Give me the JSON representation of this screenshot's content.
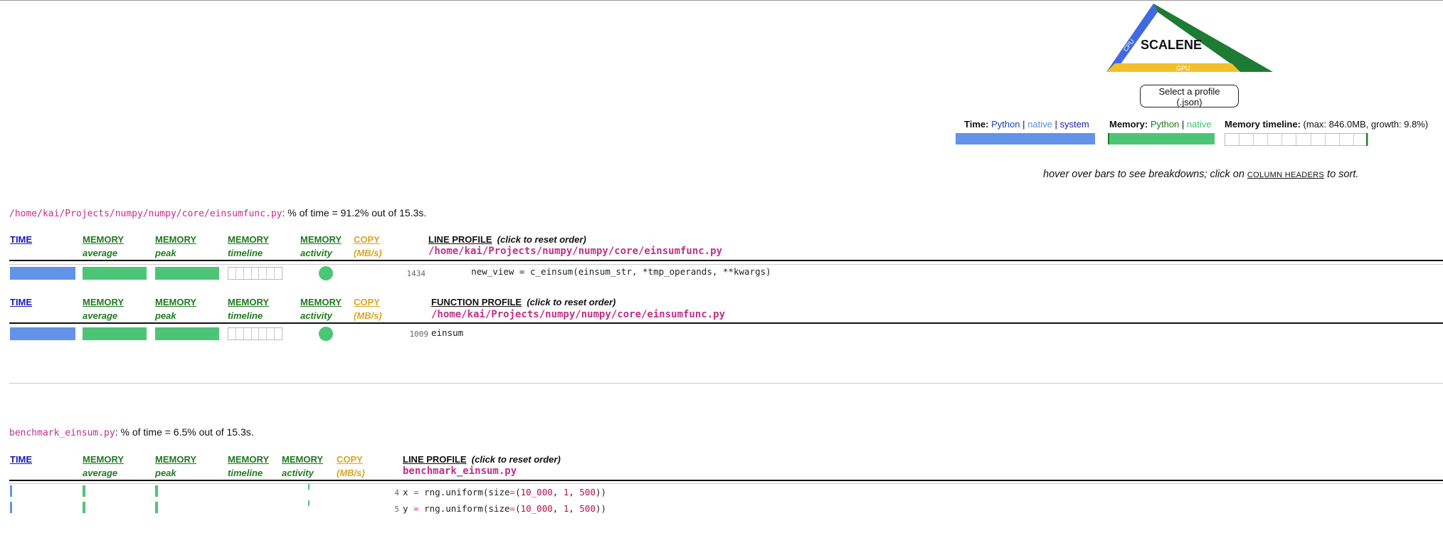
{
  "logo": {
    "name": "SCALENE",
    "cpu": "CPU",
    "memory": "MEMORY",
    "gpu": "GPU",
    "colors": {
      "blue": "#4169e1",
      "green": "#1e7b34",
      "yellow": "#f2c028"
    }
  },
  "select_profile_label": "Select a profile (.json)",
  "summary": {
    "time_label": "Time:",
    "time_python": "Python",
    "time_native": "native",
    "time_system": "system",
    "sep": "|",
    "memory_label": "Memory:",
    "memory_python": "Python",
    "memory_native": "native",
    "timeline_label": "Memory timeline:",
    "timeline_detail": "(max: 846.0MB, growth: 9.8%)"
  },
  "hint": {
    "before": "hover over bars to see breakdowns; click on ",
    "link": "COLUMN HEADERS",
    "after": " to sort."
  },
  "headers": {
    "time": "TIME",
    "memory": "MEMORY",
    "copy": "COPY",
    "average": "average",
    "peak": "peak",
    "timeline": "timeline",
    "activity": "activity",
    "mbs": "(MB/s)",
    "line_profile": "LINE PROFILE",
    "function_profile": "FUNCTION PROFILE",
    "reset": "(click to reset order)"
  },
  "files": [
    {
      "path": "/home/kai/Projects/numpy/numpy/core/einsumfunc.py",
      "summary": ": % of time = 91.2% out of 15.3s.",
      "lines": [
        {
          "no": "1434",
          "code": "        new_view = c_einsum(einsum_str, *tmp_operands, **kwargs)",
          "time_pct": 91.2
        }
      ],
      "functions": [
        {
          "no": "1009",
          "code": "einsum",
          "time_pct": 91.2
        }
      ]
    },
    {
      "path": "benchmark_einsum.py",
      "summary": ": % of time = 6.5% out of 15.3s.",
      "lines": [
        {
          "no": "4",
          "code": "x = rng.uniform(size=(10_000, 1, 500))",
          "time_pct": 3.3
        },
        {
          "no": "5",
          "code": "y = rng.uniform(size=(10_000, 1, 500))",
          "time_pct": 3.2
        }
      ]
    }
  ]
}
